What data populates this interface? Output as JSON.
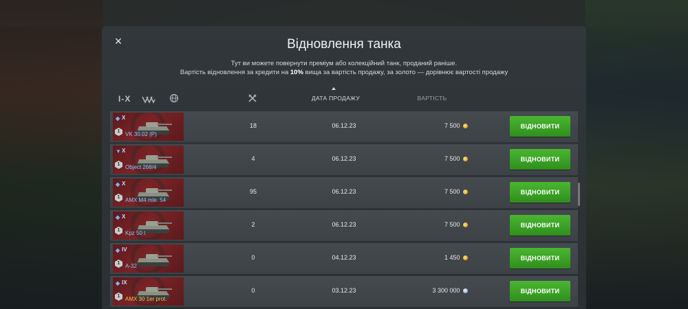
{
  "modal": {
    "title": "Відновлення танка",
    "desc_line1": "Тут ви можете повернути преміум або колекційний танк, проданий раніше.",
    "desc_line2_a": "Вартість відновлення за кредити на ",
    "desc_line2_pct": "10%",
    "desc_line2_b": " вища за вартість продажу, за золото — дорівнює вартості продажу"
  },
  "close_label": "×",
  "headers": {
    "tier_filter": "I-X",
    "sale_date": "ДАТА ПРОДАЖУ",
    "cost": "ВАРТІСТЬ"
  },
  "restore_label": "ВІДНОВИТИ",
  "rows": [
    {
      "name": "VK 30.02 (P)",
      "tier": "X",
      "type": "light",
      "battles": "18",
      "date": "06.12.23",
      "cost": "7 500",
      "currency": "credit",
      "name_style": "normal"
    },
    {
      "name": "Object 268/4",
      "tier": "X",
      "type": "td",
      "battles": "4",
      "date": "06.12.23",
      "cost": "7 500",
      "currency": "credit",
      "name_style": "normal"
    },
    {
      "name": "AMX M4 mle. 54",
      "tier": "X",
      "type": "heavy",
      "battles": "95",
      "date": "06.12.23",
      "cost": "7 500",
      "currency": "credit",
      "name_style": "normal"
    },
    {
      "name": "Kpz 50 t",
      "tier": "X",
      "type": "medium",
      "battles": "2",
      "date": "06.12.23",
      "cost": "7 500",
      "currency": "credit",
      "name_style": "normal"
    },
    {
      "name": "A-32",
      "tier": "IV",
      "type": "medium",
      "battles": "0",
      "date": "04.12.23",
      "cost": "1 450",
      "currency": "credit",
      "name_style": "normal"
    },
    {
      "name": "AMX 30 1er prot.",
      "tier": "IX",
      "type": "medium",
      "battles": "0",
      "date": "03.12.23",
      "cost": "3 300 000",
      "currency": "gold",
      "name_style": "gold"
    }
  ],
  "colors": {
    "button": "#3aa326",
    "thumb_bg": "#6e1f22",
    "name_normal": "#8fc3ff",
    "name_gold": "#f4c04a"
  }
}
